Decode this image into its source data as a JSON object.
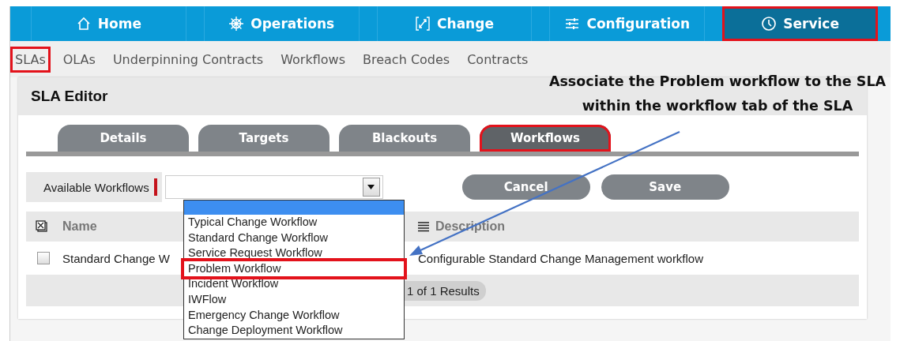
{
  "top_nav": [
    {
      "label": "Home",
      "selected": false,
      "highlighted": false
    },
    {
      "label": "Operations",
      "selected": false,
      "highlighted": false
    },
    {
      "label": "Change",
      "selected": false,
      "highlighted": false
    },
    {
      "label": "Configuration",
      "selected": false,
      "highlighted": false
    },
    {
      "label": "Service",
      "selected": true,
      "highlighted": true
    }
  ],
  "sub_nav": [
    {
      "label": "SLAs",
      "highlighted": true
    },
    {
      "label": "OLAs",
      "highlighted": false
    },
    {
      "label": "Underpinning Contracts",
      "highlighted": false
    },
    {
      "label": "Workflows",
      "highlighted": false
    },
    {
      "label": "Breach Codes",
      "highlighted": false
    },
    {
      "label": "Contracts",
      "highlighted": false
    }
  ],
  "editor": {
    "title": "SLA Editor",
    "tabs": [
      {
        "label": "Details",
        "selected": false,
        "highlighted": false
      },
      {
        "label": "Targets",
        "selected": false,
        "highlighted": false
      },
      {
        "label": "Blackouts",
        "selected": false,
        "highlighted": false
      },
      {
        "label": "Workflows",
        "selected": true,
        "highlighted": true
      }
    ],
    "field": {
      "label": "Available Workflows",
      "required": true,
      "options": [
        {
          "label": "Typical Change Workflow",
          "highlighted": false
        },
        {
          "label": "Standard Change Workflow",
          "highlighted": false
        },
        {
          "label": "Service Request Workflow",
          "highlighted": false
        },
        {
          "label": "Problem Workflow",
          "highlighted": true
        },
        {
          "label": "Incident Workflow",
          "highlighted": false
        },
        {
          "label": "IWFlow",
          "highlighted": false
        },
        {
          "label": "Emergency Change Workflow",
          "highlighted": false
        },
        {
          "label": "Change Deployment Workflow",
          "highlighted": false
        }
      ]
    },
    "buttons": [
      "Cancel",
      "Save"
    ],
    "table": {
      "columns": [
        "Name",
        "Description"
      ],
      "rows": [
        {
          "checked": false,
          "cells": [
            "Standard Change W",
            "Configurable Standard Change Management workflow"
          ]
        }
      ],
      "pager": "1 of 1 Results"
    }
  },
  "annotation": {
    "lines": [
      "Associate the Problem workflow to the SLA",
      "within the workflow tab of the SLA"
    ]
  }
}
